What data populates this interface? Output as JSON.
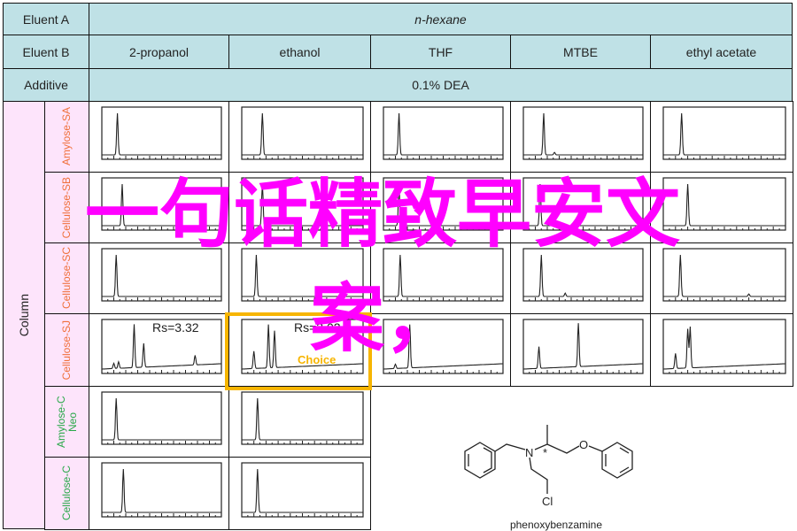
{
  "header": {
    "eluent_a_label": "Eluent A",
    "eluent_a_value": "n-hexane",
    "eluent_b_label": "Eluent B",
    "eluent_b_values": [
      "2-propanol",
      "ethanol",
      "THF",
      "MTBE",
      "ethyl acetate"
    ],
    "additive_label": "Additive",
    "additive_value": "0.1% DEA"
  },
  "column_label": "Column",
  "columns": [
    {
      "name": "Amylose-SA",
      "color": "#f0703c"
    },
    {
      "name": "Cellulose-SB",
      "color": "#f0703c"
    },
    {
      "name": "Cellulose-SC",
      "color": "#f0703c"
    },
    {
      "name": "Cellulose-SJ",
      "color": "#f0703c"
    },
    {
      "name": "Amylose-C Neo",
      "color": "#2aa84a"
    },
    {
      "name": "Cellulose-C",
      "color": "#2aa84a"
    }
  ],
  "annotations": {
    "rs_1": "Rs=3.32",
    "rs_2": "Rs=3.02",
    "choice": "Choice"
  },
  "chromatograms": [
    [
      [
        [
          1.3,
          1
        ]
      ],
      [
        [
          1.7,
          1
        ]
      ],
      [
        [
          1.3,
          1
        ]
      ],
      [
        [
          1.7,
          1
        ],
        [
          2.6,
          0.06
        ]
      ],
      [
        [
          1.5,
          1
        ]
      ]
    ],
    [
      [
        [
          1.7,
          1
        ]
      ],
      [
        [
          1.7,
          1
        ]
      ],
      [
        [
          1.3,
          1
        ]
      ],
      [
        [
          1.4,
          1
        ]
      ],
      [
        [
          2.0,
          1
        ]
      ]
    ],
    [
      [
        [
          1.2,
          1
        ]
      ],
      [
        [
          1.2,
          1
        ]
      ],
      [
        [
          1.4,
          1
        ]
      ],
      [
        [
          1.5,
          1
        ],
        [
          3.5,
          0.08
        ]
      ],
      [
        [
          1.4,
          1
        ],
        [
          7.0,
          0.06
        ]
      ]
    ],
    [
      [
        [
          1.0,
          0.12
        ],
        [
          1.4,
          0.15
        ],
        [
          2.7,
          1
        ],
        [
          3.5,
          0.55
        ],
        [
          7.8,
          0.22
        ]
      ],
      [
        [
          1.0,
          0.4
        ],
        [
          2.2,
          1
        ],
        [
          2.7,
          0.85
        ]
      ],
      [
        [
          1.0,
          0.1
        ],
        [
          2.2,
          1
        ]
      ],
      [
        [
          1.3,
          0.5
        ],
        [
          4.6,
          1
        ]
      ],
      [
        [
          1.0,
          0.35
        ],
        [
          2.0,
          0.9
        ],
        [
          2.2,
          0.95
        ]
      ]
    ],
    [
      [
        [
          1.2,
          1
        ]
      ],
      [
        [
          1.3,
          1
        ]
      ]
    ],
    [
      [
        [
          1.8,
          1
        ]
      ],
      [
        [
          1.3,
          1
        ]
      ]
    ]
  ],
  "molecule": {
    "name": "phenoxybenzamine",
    "atoms": [
      "N",
      "O",
      "Cl",
      "*"
    ]
  },
  "overlay": {
    "line1": "一句话精致早安文",
    "line2": "案，",
    "color": "#ff00ff"
  }
}
